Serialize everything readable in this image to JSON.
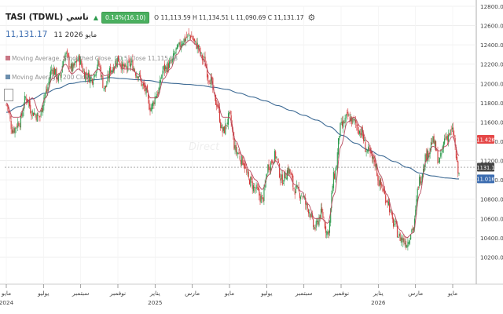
{
  "header": {
    "title": "TASI  (TDWL)  تاسي",
    "change_badge": "0.14%(16.10)",
    "ohlc": "O 11,113.59  H 11,134.51  L 11,090.69  C 11,131.17",
    "gear_icon": "gear-icon",
    "up_icon": "triangle-up-icon"
  },
  "price_line": {
    "value": "11,131.17",
    "date": "11 مايو 2026"
  },
  "indicators": {
    "ma1": "Moving Average, Smoothed Close, 20,5 Close 11,115.38",
    "ma2": "Moving Average, 200 Close"
  },
  "watermark": "Direct",
  "colors": {
    "up": "#2e9b4e",
    "down": "#d23a3a",
    "ma_red": "#b84a5e",
    "ma_blue": "#3d6a94",
    "tag_red": "#e54646",
    "tag_dark": "#454545",
    "tag_blue": "#3b6cb0"
  },
  "chart_data": {
    "type": "candlestick",
    "y_range": [
      10000,
      12800
    ],
    "y_ticks": [
      "12800.00",
      "12600.00",
      "12400.00",
      "12200.00",
      "12000.00",
      "11800.00",
      "11600.00",
      "11400.00",
      "11200.00",
      "11000.00",
      "10800.00",
      "10600.00",
      "10400.00",
      "10200.00"
    ],
    "x_ticks": [
      {
        "label": "مايو",
        "sub": "2024"
      },
      {
        "label": "يوليو"
      },
      {
        "label": "سبتمبر"
      },
      {
        "label": "نوفمبر"
      },
      {
        "label": "يناير",
        "sub": "2025"
      },
      {
        "label": "مارس"
      },
      {
        "label": "مايو"
      },
      {
        "label": "يوليو"
      },
      {
        "label": "سبتمبر"
      },
      {
        "label": "نوفمبر"
      },
      {
        "label": "يناير",
        "sub": "2026"
      },
      {
        "label": "مارس"
      },
      {
        "label": "مايو"
      }
    ],
    "close_series": [
      11780,
      11520,
      11600,
      11850,
      11700,
      11650,
      11900,
      12150,
      12050,
      12300,
      12150,
      12250,
      12100,
      12050,
      12200,
      11950,
      12150,
      12250,
      12150,
      12200,
      12100,
      11950,
      11750,
      11900,
      12150,
      12200,
      12350,
      12450,
      12500,
      12400,
      12250,
      12050,
      11800,
      11500,
      11650,
      11300,
      11200,
      11000,
      10900,
      10800,
      11150,
      11250,
      11000,
      11100,
      10900,
      10850,
      10700,
      10500,
      10650,
      10450,
      11050,
      11550,
      11650,
      11600,
      11500,
      11300,
      11200,
      10950,
      10800,
      10550,
      10400,
      10350,
      10500,
      11000,
      11250,
      11400,
      11200,
      11450,
      11500,
      11050
    ],
    "ma_smoothed": [
      11800,
      11650,
      11650,
      11800,
      11850,
      11700,
      11850,
      12050,
      12100,
      12200,
      12100,
      12150,
      12100,
      12080,
      12150,
      12080,
      12100,
      12200,
      12150,
      12150,
      12100,
      12000,
      11850,
      11850,
      12050,
      12150,
      12300,
      12400,
      12450,
      12400,
      12250,
      12100,
      11850,
      11650,
      11650,
      11400,
      11250,
      11100,
      11000,
      10900,
      11050,
      11200,
      11100,
      11050,
      10950,
      10880,
      10750,
      10600,
      10600,
      10550,
      10850,
      11350,
      11600,
      11650,
      11550,
      11400,
      11250,
      11050,
      10850,
      10650,
      10480,
      10400,
      10450,
      10850,
      11200,
      11350,
      11300,
      11350,
      11450,
      11250
    ],
    "ma_200": [
      11700,
      11760,
      11840,
      11900,
      11950,
      12000,
      12020,
      12040,
      12060,
      12050,
      12040,
      12030,
      12010,
      12000,
      11990,
      11980,
      11960,
      11940,
      11900,
      11860,
      11820,
      11770,
      11720,
      11670,
      11620,
      11550,
      11460,
      11380,
      11310,
      11250,
      11190,
      11130,
      11070,
      11040,
      11020,
      11010
    ],
    "last_close": 11131.17,
    "price_tags": [
      {
        "label": "11.42K",
        "value": 11420,
        "color_key": "tag_red"
      },
      {
        "label": "11131.17",
        "value": 11131.17,
        "color_key": "tag_dark"
      },
      {
        "label": "11.01K",
        "value": 11010,
        "color_key": "tag_blue"
      }
    ]
  }
}
